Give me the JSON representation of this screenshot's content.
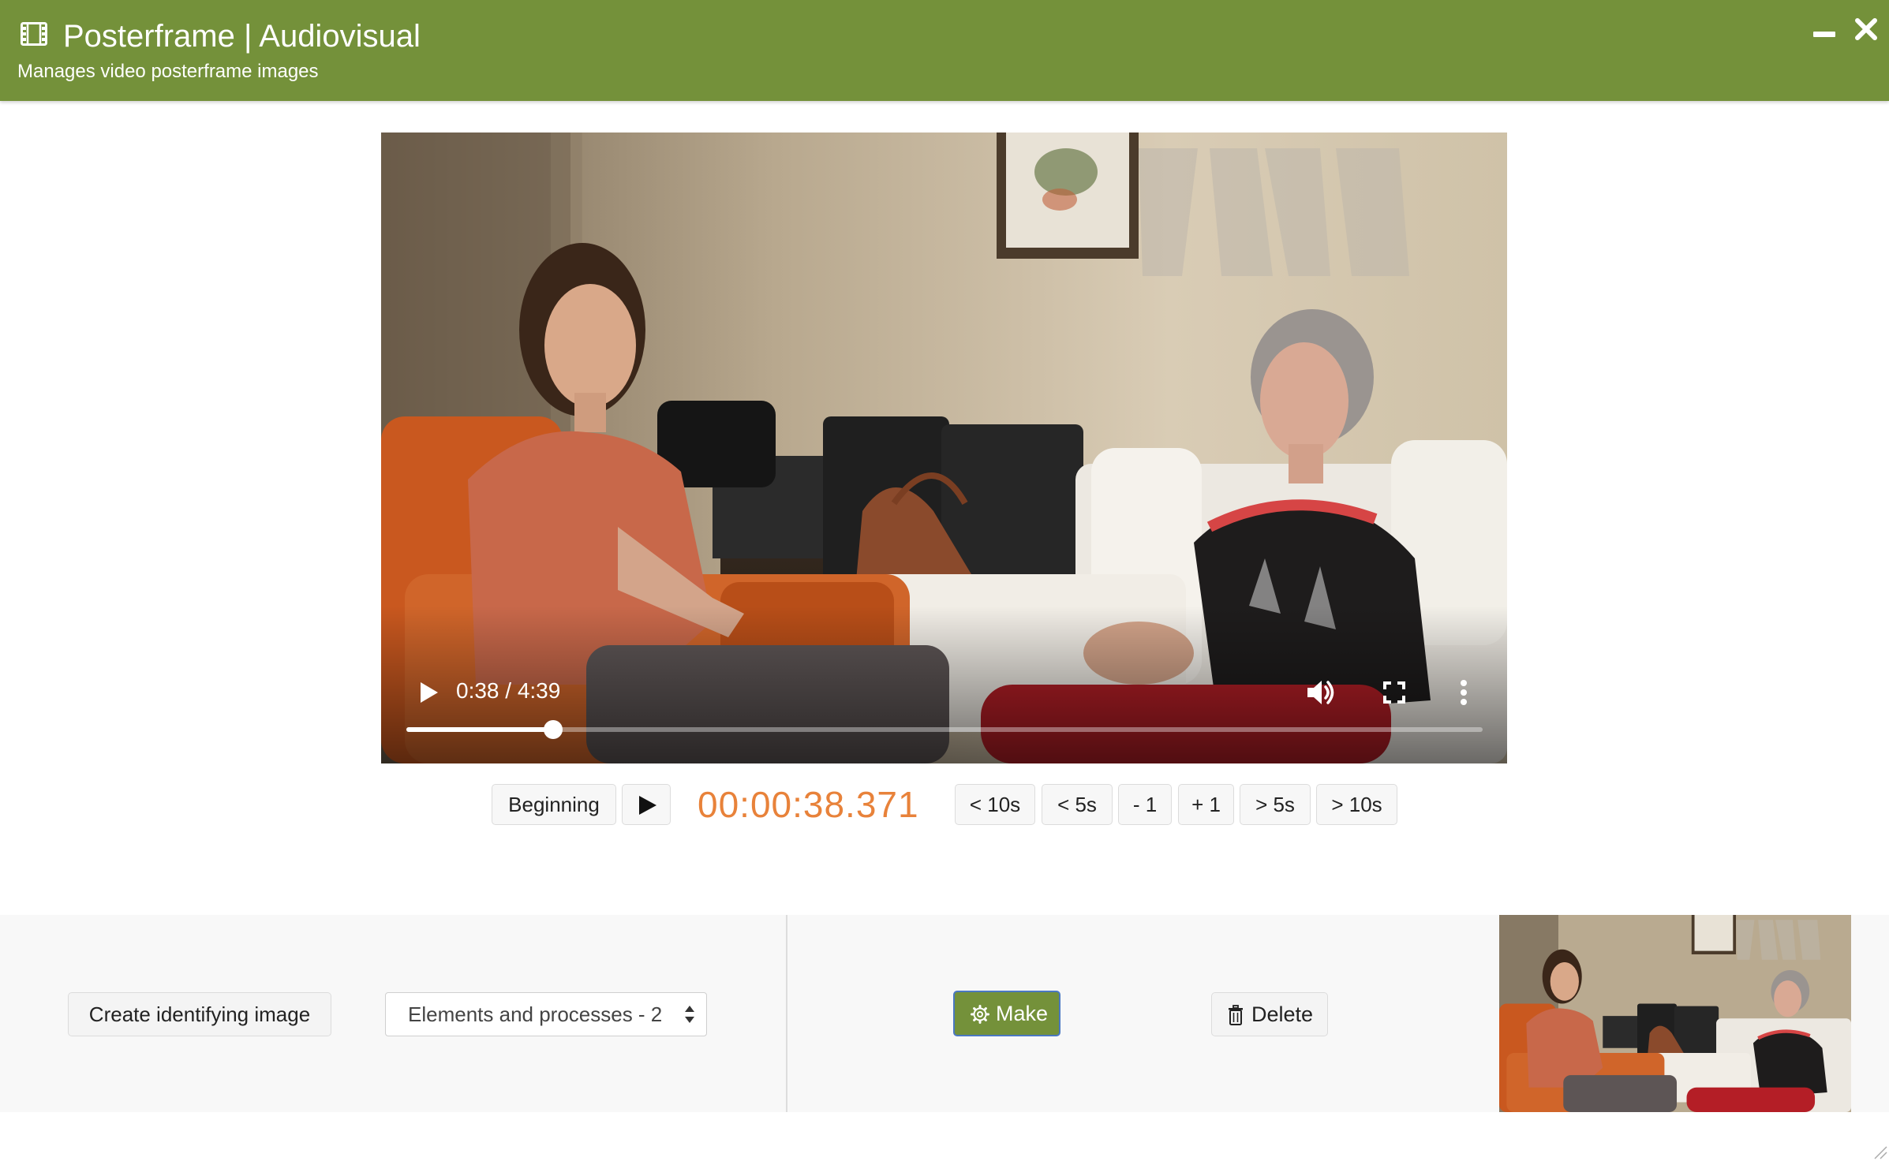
{
  "header": {
    "title": "Posterframe | Audiovisual",
    "subtitle": "Manages video posterframe images",
    "icon": "film-icon",
    "background_color": "#74913a"
  },
  "player": {
    "current_time": "0:38",
    "duration": "4:39",
    "time_display": "0:38 / 4:39",
    "progress_fraction": 0.136
  },
  "transport": {
    "beginning_label": "Beginning",
    "timecode": "00:00:38.371",
    "timecode_color": "#e8823a",
    "back_10s_label": "< 10s",
    "back_5s_label": "< 5s",
    "back_1_label": "- 1",
    "fwd_1_label": "+ 1",
    "fwd_5s_label": "> 5s",
    "fwd_10s_label": "> 10s"
  },
  "bottom": {
    "create_label": "Create identifying image",
    "select_value": "Elements and processes - 2",
    "make_label": "Make",
    "delete_label": "Delete",
    "make_color": "#74913a"
  }
}
